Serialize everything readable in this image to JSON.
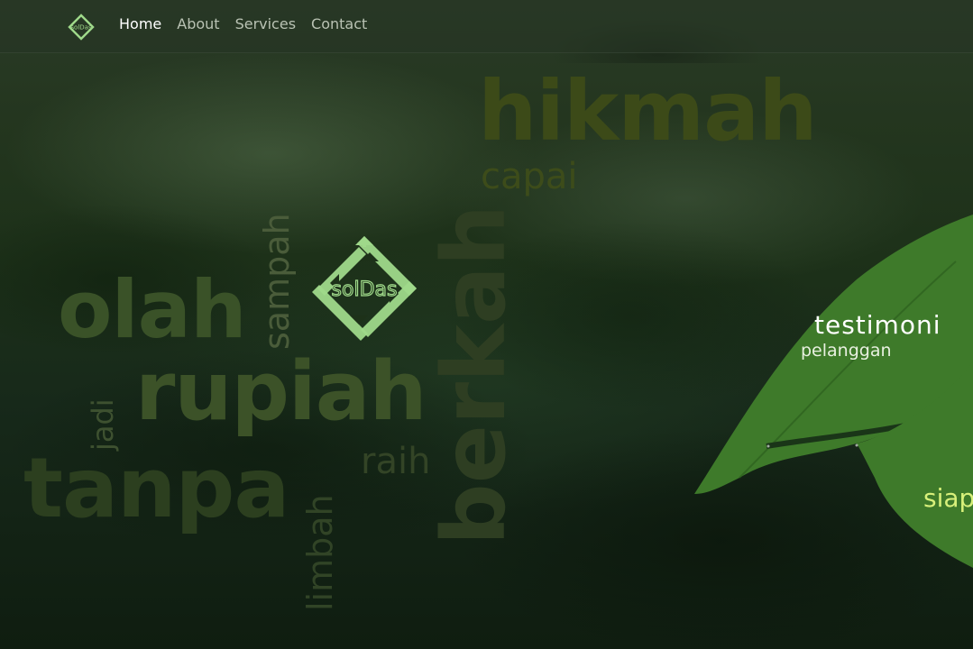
{
  "nav": {
    "items": [
      {
        "label": "Home",
        "active": true
      },
      {
        "label": "About",
        "active": false
      },
      {
        "label": "Services",
        "active": false
      },
      {
        "label": "Contact",
        "active": false
      }
    ],
    "logo_text": "solDas"
  },
  "hero": {
    "words": {
      "hikmah": "hikmah",
      "capai": "capai",
      "olah": "olah",
      "sampah": "sampah",
      "rupiah": "rupiah",
      "jadi": "jadi",
      "tanpa": "tanpa",
      "raih": "raih",
      "limbah": "limbah",
      "berkah": "berkah"
    },
    "logo_text": "solDas"
  },
  "testimonial": {
    "title": "testimoni",
    "subtitle": "pelanggan",
    "teaser": "siap"
  },
  "colors": {
    "logo_green": "#9fd98a",
    "leaf_green": "#3e7a2a",
    "teaser_yellow": "#d8f07a"
  }
}
